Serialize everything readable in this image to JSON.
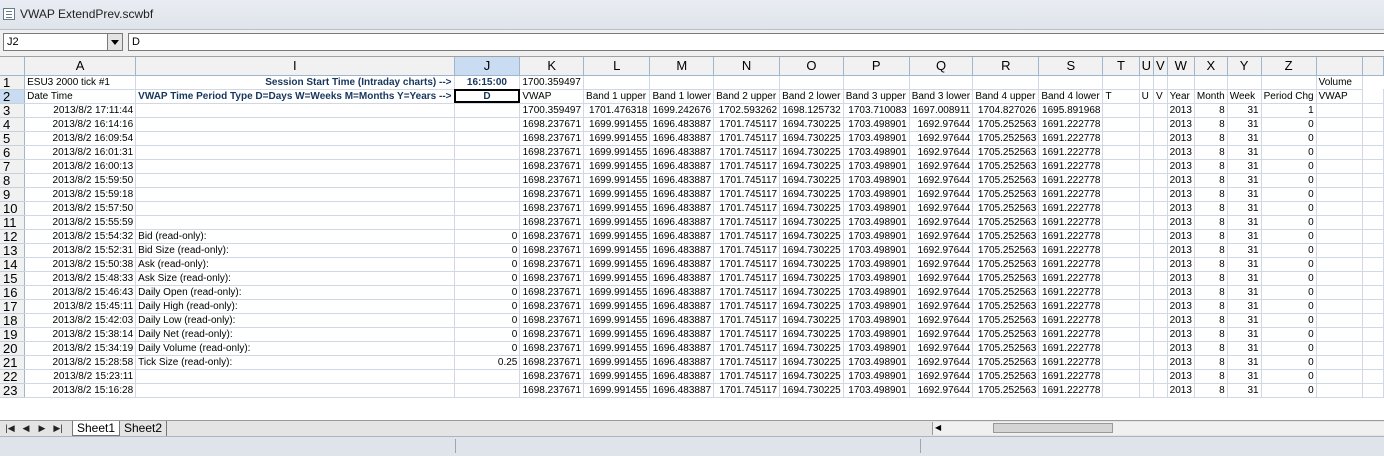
{
  "window": {
    "title": "VWAP ExtendPrev.scwbf"
  },
  "formula_bar": {
    "name_box": "J2",
    "formula": "D"
  },
  "columns": [
    "A",
    "I",
    "J",
    "K",
    "L",
    "M",
    "N",
    "O",
    "P",
    "Q",
    "R",
    "S",
    "T",
    "U",
    "V",
    "W",
    "X",
    "Y",
    "Z",
    ""
  ],
  "selected_column": "J",
  "row1": {
    "a": "ESU3  2000 tick  #1",
    "i": "Session Start Time (Intraday charts) -->",
    "j": "16:15:00",
    "k": "1700.359497",
    "last": "Volume"
  },
  "row2": {
    "a": "Date Time",
    "i": "VWAP Time Period Type D=Days W=Weeks M=Months Y=Years -->",
    "j": "D",
    "headers": [
      "VWAP",
      "Band 1 upper",
      "Band 1 lower",
      "Band 2 upper",
      "Band 2 lower",
      "Band 3 upper",
      "Band 3 lower",
      "Band 4 upper",
      "Band 4 lower",
      "T",
      "U",
      "V",
      "Year",
      "Month",
      "Week",
      "Period Chg",
      "VWAP"
    ]
  },
  "rows": [
    {
      "n": "3",
      "a": "2013/8/2 17:11:44",
      "i": "",
      "j": "",
      "v": [
        "1700.359497",
        "1701.476318",
        "1699.242676",
        "1702.593262",
        "1698.125732",
        "1703.710083",
        "1697.008911",
        "1704.827026",
        "1695.891968",
        "",
        "",
        "",
        "2013",
        "8",
        "31",
        "1",
        ""
      ]
    },
    {
      "n": "4",
      "a": "2013/8/2 16:14:16",
      "i": "",
      "j": "",
      "v": [
        "1698.237671",
        "1699.991455",
        "1696.483887",
        "1701.745117",
        "1694.730225",
        "1703.498901",
        "1692.97644",
        "1705.252563",
        "1691.222778",
        "",
        "",
        "",
        "2013",
        "8",
        "31",
        "0",
        ""
      ]
    },
    {
      "n": "5",
      "a": "2013/8/2 16:09:54",
      "i": "",
      "j": "",
      "v": [
        "1698.237671",
        "1699.991455",
        "1696.483887",
        "1701.745117",
        "1694.730225",
        "1703.498901",
        "1692.97644",
        "1705.252563",
        "1691.222778",
        "",
        "",
        "",
        "2013",
        "8",
        "31",
        "0",
        ""
      ]
    },
    {
      "n": "6",
      "a": "2013/8/2 16:01:31",
      "i": "",
      "j": "",
      "v": [
        "1698.237671",
        "1699.991455",
        "1696.483887",
        "1701.745117",
        "1694.730225",
        "1703.498901",
        "1692.97644",
        "1705.252563",
        "1691.222778",
        "",
        "",
        "",
        "2013",
        "8",
        "31",
        "0",
        ""
      ]
    },
    {
      "n": "7",
      "a": "2013/8/2 16:00:13",
      "i": "",
      "j": "",
      "v": [
        "1698.237671",
        "1699.991455",
        "1696.483887",
        "1701.745117",
        "1694.730225",
        "1703.498901",
        "1692.97644",
        "1705.252563",
        "1691.222778",
        "",
        "",
        "",
        "2013",
        "8",
        "31",
        "0",
        ""
      ]
    },
    {
      "n": "8",
      "a": "2013/8/2 15:59:50",
      "i": "",
      "j": "",
      "v": [
        "1698.237671",
        "1699.991455",
        "1696.483887",
        "1701.745117",
        "1694.730225",
        "1703.498901",
        "1692.97644",
        "1705.252563",
        "1691.222778",
        "",
        "",
        "",
        "2013",
        "8",
        "31",
        "0",
        ""
      ]
    },
    {
      "n": "9",
      "a": "2013/8/2 15:59:18",
      "i": "",
      "j": "",
      "v": [
        "1698.237671",
        "1699.991455",
        "1696.483887",
        "1701.745117",
        "1694.730225",
        "1703.498901",
        "1692.97644",
        "1705.252563",
        "1691.222778",
        "",
        "",
        "",
        "2013",
        "8",
        "31",
        "0",
        ""
      ]
    },
    {
      "n": "10",
      "a": "2013/8/2 15:57:50",
      "i": "",
      "j": "",
      "v": [
        "1698.237671",
        "1699.991455",
        "1696.483887",
        "1701.745117",
        "1694.730225",
        "1703.498901",
        "1692.97644",
        "1705.252563",
        "1691.222778",
        "",
        "",
        "",
        "2013",
        "8",
        "31",
        "0",
        ""
      ]
    },
    {
      "n": "11",
      "a": "2013/8/2 15:55:59",
      "i": "",
      "j": "",
      "v": [
        "1698.237671",
        "1699.991455",
        "1696.483887",
        "1701.745117",
        "1694.730225",
        "1703.498901",
        "1692.97644",
        "1705.252563",
        "1691.222778",
        "",
        "",
        "",
        "2013",
        "8",
        "31",
        "0",
        ""
      ]
    },
    {
      "n": "12",
      "a": "2013/8/2 15:54:32",
      "i": "Bid (read-only):",
      "j": "0",
      "v": [
        "1698.237671",
        "1699.991455",
        "1696.483887",
        "1701.745117",
        "1694.730225",
        "1703.498901",
        "1692.97644",
        "1705.252563",
        "1691.222778",
        "",
        "",
        "",
        "2013",
        "8",
        "31",
        "0",
        ""
      ]
    },
    {
      "n": "13",
      "a": "2013/8/2 15:52:31",
      "i": "Bid Size (read-only):",
      "j": "0",
      "v": [
        "1698.237671",
        "1699.991455",
        "1696.483887",
        "1701.745117",
        "1694.730225",
        "1703.498901",
        "1692.97644",
        "1705.252563",
        "1691.222778",
        "",
        "",
        "",
        "2013",
        "8",
        "31",
        "0",
        ""
      ]
    },
    {
      "n": "14",
      "a": "2013/8/2 15:50:38",
      "i": "Ask (read-only):",
      "j": "0",
      "v": [
        "1698.237671",
        "1699.991455",
        "1696.483887",
        "1701.745117",
        "1694.730225",
        "1703.498901",
        "1692.97644",
        "1705.252563",
        "1691.222778",
        "",
        "",
        "",
        "2013",
        "8",
        "31",
        "0",
        ""
      ]
    },
    {
      "n": "15",
      "a": "2013/8/2 15:48:33",
      "i": "Ask Size (read-only):",
      "j": "0",
      "v": [
        "1698.237671",
        "1699.991455",
        "1696.483887",
        "1701.745117",
        "1694.730225",
        "1703.498901",
        "1692.97644",
        "1705.252563",
        "1691.222778",
        "",
        "",
        "",
        "2013",
        "8",
        "31",
        "0",
        ""
      ]
    },
    {
      "n": "16",
      "a": "2013/8/2 15:46:43",
      "i": "Daily Open (read-only):",
      "j": "0",
      "v": [
        "1698.237671",
        "1699.991455",
        "1696.483887",
        "1701.745117",
        "1694.730225",
        "1703.498901",
        "1692.97644",
        "1705.252563",
        "1691.222778",
        "",
        "",
        "",
        "2013",
        "8",
        "31",
        "0",
        ""
      ]
    },
    {
      "n": "17",
      "a": "2013/8/2 15:45:11",
      "i": "Daily High (read-only):",
      "j": "0",
      "v": [
        "1698.237671",
        "1699.991455",
        "1696.483887",
        "1701.745117",
        "1694.730225",
        "1703.498901",
        "1692.97644",
        "1705.252563",
        "1691.222778",
        "",
        "",
        "",
        "2013",
        "8",
        "31",
        "0",
        ""
      ]
    },
    {
      "n": "18",
      "a": "2013/8/2 15:42:03",
      "i": "Daily Low (read-only):",
      "j": "0",
      "v": [
        "1698.237671",
        "1699.991455",
        "1696.483887",
        "1701.745117",
        "1694.730225",
        "1703.498901",
        "1692.97644",
        "1705.252563",
        "1691.222778",
        "",
        "",
        "",
        "2013",
        "8",
        "31",
        "0",
        ""
      ]
    },
    {
      "n": "19",
      "a": "2013/8/2 15:38:14",
      "i": "Daily Net (read-only):",
      "j": "0",
      "v": [
        "1698.237671",
        "1699.991455",
        "1696.483887",
        "1701.745117",
        "1694.730225",
        "1703.498901",
        "1692.97644",
        "1705.252563",
        "1691.222778",
        "",
        "",
        "",
        "2013",
        "8",
        "31",
        "0",
        ""
      ]
    },
    {
      "n": "20",
      "a": "2013/8/2 15:34:19",
      "i": "Daily Volume (read-only):",
      "j": "0",
      "v": [
        "1698.237671",
        "1699.991455",
        "1696.483887",
        "1701.745117",
        "1694.730225",
        "1703.498901",
        "1692.97644",
        "1705.252563",
        "1691.222778",
        "",
        "",
        "",
        "2013",
        "8",
        "31",
        "0",
        ""
      ]
    },
    {
      "n": "21",
      "a": "2013/8/2 15:28:58",
      "i": "Tick Size (read-only):",
      "j": "0.25",
      "v": [
        "1698.237671",
        "1699.991455",
        "1696.483887",
        "1701.745117",
        "1694.730225",
        "1703.498901",
        "1692.97644",
        "1705.252563",
        "1691.222778",
        "",
        "",
        "",
        "2013",
        "8",
        "31",
        "0",
        ""
      ]
    },
    {
      "n": "22",
      "a": "2013/8/2 15:23:11",
      "i": "",
      "j": "",
      "v": [
        "1698.237671",
        "1699.991455",
        "1696.483887",
        "1701.745117",
        "1694.730225",
        "1703.498901",
        "1692.97644",
        "1705.252563",
        "1691.222778",
        "",
        "",
        "",
        "2013",
        "8",
        "31",
        "0",
        ""
      ]
    },
    {
      "n": "23",
      "a": "2013/8/2 15:16:28",
      "i": "",
      "j": "",
      "v": [
        "1698.237671",
        "1699.991455",
        "1696.483887",
        "1701.745117",
        "1694.730225",
        "1703.498901",
        "1692.97644",
        "1705.252563",
        "1691.222778",
        "",
        "",
        "",
        "2013",
        "8",
        "31",
        "0",
        ""
      ]
    }
  ],
  "sheet_tabs": [
    "Sheet1",
    "Sheet2"
  ],
  "active_sheet": "Sheet1",
  "colors": {
    "header_bg": "#f1f1f1",
    "selected_header_bg": "#c9dcf2",
    "label_blue": "#17365d",
    "grid_line": "#d0d7e5"
  }
}
